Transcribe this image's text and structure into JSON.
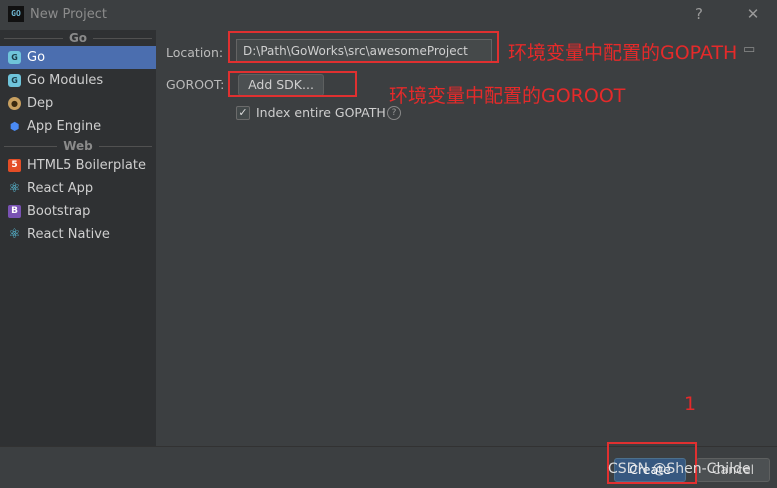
{
  "window": {
    "title": "New Project",
    "app_icon": "GO",
    "close_glyph": "✕"
  },
  "sidebar": {
    "groups": [
      {
        "label": "Go",
        "items": [
          {
            "label": "Go",
            "icon": "go-icon",
            "selected": true
          },
          {
            "label": "Go Modules",
            "icon": "go-modules-icon"
          },
          {
            "label": "Dep",
            "icon": "dep-gopher-icon"
          },
          {
            "label": "App Engine",
            "icon": "app-engine-icon"
          }
        ]
      },
      {
        "label": "Web",
        "items": [
          {
            "label": "HTML5 Boilerplate",
            "icon": "html5-icon"
          },
          {
            "label": "React App",
            "icon": "react-icon"
          },
          {
            "label": "Bootstrap",
            "icon": "bootstrap-icon"
          },
          {
            "label": "React Native",
            "icon": "react-icon"
          }
        ]
      }
    ]
  },
  "form": {
    "location_label": "Location:",
    "location_value": "D:\\Path\\GoWorks\\src\\awesomeProject",
    "goroot_label": "GOROOT:",
    "add_sdk_label": "Add SDK...",
    "index_label": "Index entire GOPATH",
    "index_checked": true
  },
  "footer": {
    "create_label": "Create",
    "cancel_label": "Cancel"
  },
  "annotations": {
    "gopath_note": "环境变量中配置的GOPATH",
    "goroot_note": "环境变量中配置的GOROOT",
    "step_number": "1",
    "color": "#e03030"
  },
  "watermark": "CSDN @Shen-Childe"
}
